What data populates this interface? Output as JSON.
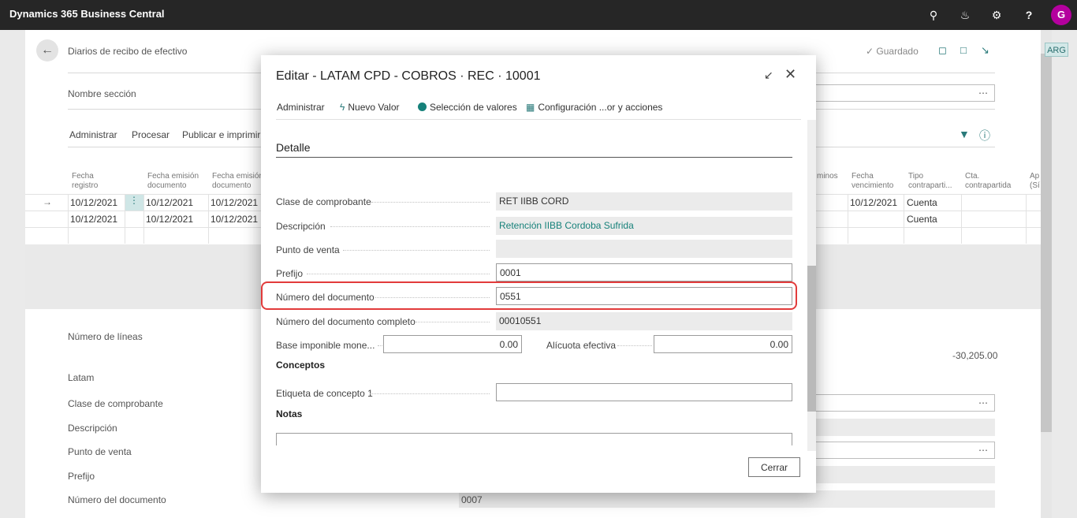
{
  "app": {
    "brand": "Dynamics 365 Business Central",
    "avatar_initial": "G"
  },
  "topbar_icons": [
    "search-icon",
    "bell-icon",
    "gear-icon",
    "help-icon"
  ],
  "page": {
    "title": "Diarios de recibo de efectivo",
    "saved": "Guardado",
    "section_label": "Nombre sección",
    "menu": [
      "Administrar",
      "Procesar",
      "Publicar e imprimir"
    ],
    "grid": {
      "headers": [
        {
          "l1": "Fecha",
          "l2": "registro"
        },
        {
          "l1": "Fecha emisión",
          "l2": "documento"
        },
        {
          "l1": "Fecha emisión",
          "l2": "documento"
        },
        {
          "l1": "",
          "l2": "minos"
        },
        {
          "l1": "Fecha",
          "l2": "vencimiento"
        },
        {
          "l1": "Tipo",
          "l2": "contraparti..."
        },
        {
          "l1": "Cta.",
          "l2": "contrapartida"
        },
        {
          "l1": "Ap",
          "l2": "(Sí"
        }
      ],
      "rows": [
        {
          "c1": "10/12/2021",
          "c2": "10/12/2021",
          "c3": "10/12/2021",
          "venc": "10/12/2021",
          "tipo": "Cuenta"
        },
        {
          "c1": "10/12/2021",
          "c2": "10/12/2021",
          "c3": "10/12/2021",
          "venc": "",
          "tipo": "Cuenta"
        }
      ]
    },
    "num_lineas": "Número de líneas",
    "amount": "-30,205.00",
    "latam": "Latam",
    "fields": [
      "Clase de comprobante",
      "Descripción",
      "Punto de venta",
      "Prefijo",
      "Número del documento"
    ],
    "doc_value": "0007",
    "region_badge": "ARG"
  },
  "modal": {
    "title": "Editar - LATAM CPD - COBROS · REC · 10001",
    "toolbar": {
      "administrar": "Administrar",
      "nuevo_valor": "Nuevo Valor",
      "seleccion": "Selección de valores",
      "config": "Configuración ...or y acciones"
    },
    "section": "Detalle",
    "fields": {
      "clase": {
        "label": "Clase de comprobante",
        "value": "RET IIBB CORD"
      },
      "descripcion": {
        "label": "Descripción",
        "value": "Retención IIBB Cordoba Sufrida"
      },
      "punto_venta": {
        "label": "Punto de venta",
        "value": ""
      },
      "prefijo": {
        "label": "Prefijo",
        "value": "0001"
      },
      "numero_doc": {
        "label": "Número del documento",
        "value": "0551"
      },
      "numero_completo": {
        "label": "Número del documento completo",
        "value": "00010551"
      },
      "base_imponible": {
        "label": "Base imponible mone...",
        "value": "0.00"
      },
      "alicuota": {
        "label": "Alícuota efectiva",
        "value": "0.00"
      }
    },
    "conceptos": "Conceptos",
    "etiqueta": {
      "label": "Etiqueta de concepto 1",
      "value": ""
    },
    "notas": "Notas",
    "close_label": "Cerrar"
  },
  "colors": {
    "accent": "#16817a",
    "highlight": "#e23b3b",
    "topbar": "#262626"
  }
}
